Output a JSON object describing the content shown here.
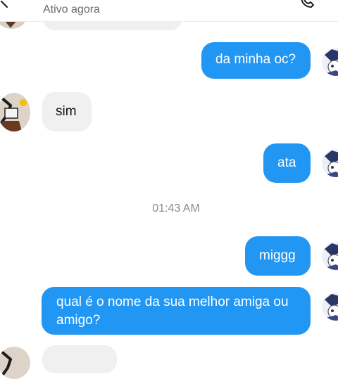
{
  "header": {
    "status": "Ativo agora"
  },
  "messages": [
    {
      "id": "m1",
      "side": "out",
      "text": "da minha oc?"
    },
    {
      "id": "m2",
      "side": "in",
      "text": "sim"
    },
    {
      "id": "m3",
      "side": "out",
      "text": "ata"
    },
    {
      "id": "m4",
      "side": "out",
      "text": "miggg"
    },
    {
      "id": "m5",
      "side": "out",
      "text": "qual é o nome da sua melhor amiga ou amigo?"
    }
  ],
  "timestamp": "01:43 AM",
  "colors": {
    "outgoing": "#2196f3",
    "incoming": "#f0f0f0"
  }
}
